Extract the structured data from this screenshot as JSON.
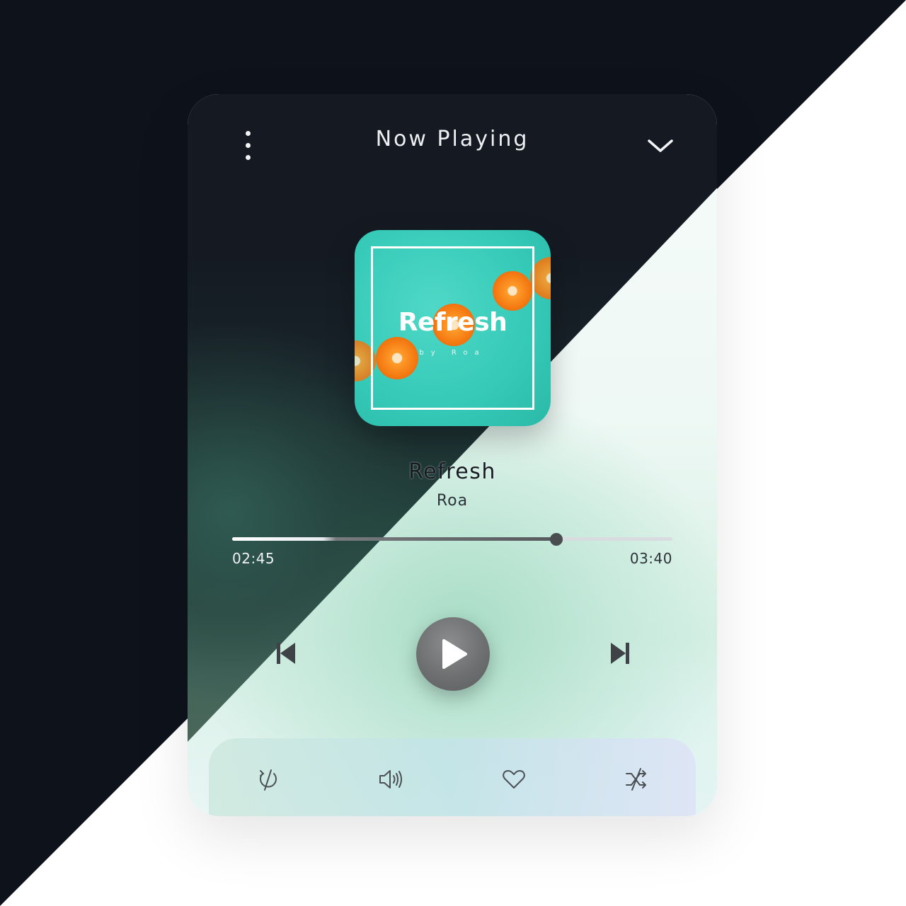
{
  "header": {
    "title": "Now Playing",
    "menu_icon": "vertical-dots-icon",
    "collapse_icon": "chevron-down-icon"
  },
  "album_art": {
    "title": "Refresh",
    "subtitle": "by Roa",
    "background_color": "#35c9b7"
  },
  "track": {
    "title": "Refresh",
    "artist": "Roa"
  },
  "playback": {
    "current_time": "02:45",
    "total_time": "03:40",
    "progress": 0.737,
    "state": "paused"
  },
  "controls": {
    "previous_icon": "skip-previous-icon",
    "play_icon": "play-icon",
    "next_icon": "skip-next-icon"
  },
  "bottom_bar": {
    "icons": [
      "repeat-off-icon",
      "volume-icon",
      "heart-icon",
      "shuffle-off-icon"
    ]
  },
  "colors": {
    "dark_background": "#0e121b",
    "card_dark": "#151a22",
    "play_button": "#6d6f71",
    "icon_dark": "#3f4347"
  }
}
